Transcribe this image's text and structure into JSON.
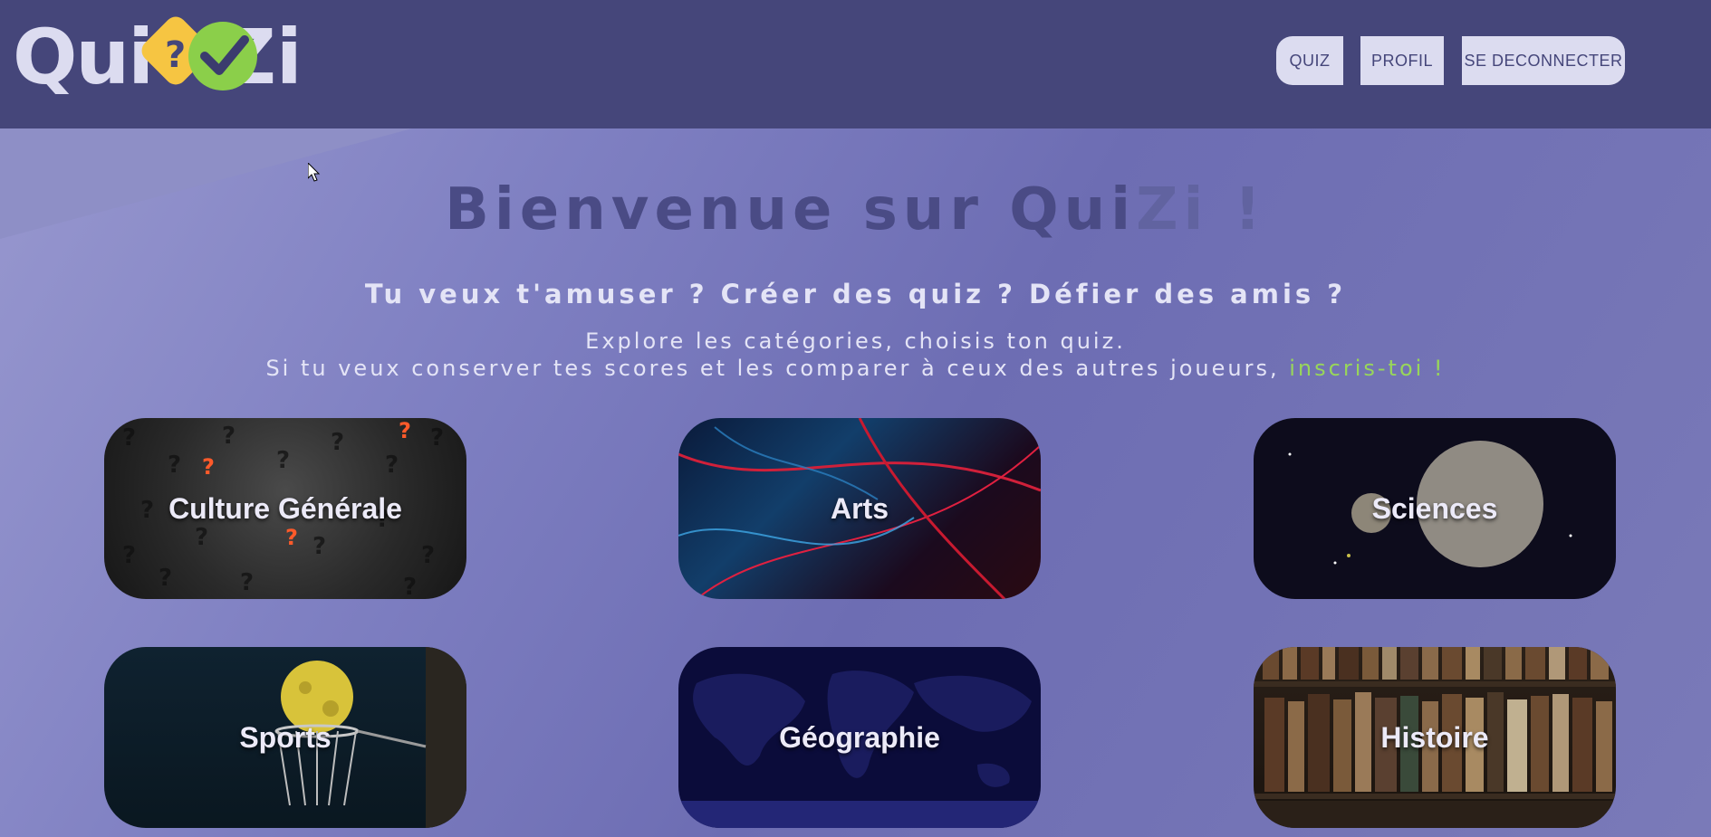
{
  "header": {
    "logo_text": "QuiZi",
    "nav": {
      "quiz": "QUIZ",
      "profil": "PROFIL",
      "logout": "SE DECONNECTER"
    }
  },
  "hero": {
    "title_main": "Bienvenue sur Qui",
    "title_fade": "Zi !",
    "subtitle": "Tu veux t'amuser ? Créer des quiz ? Défier des amis ?",
    "intro_line1": "Explore les catégories, choisis ton quiz.",
    "intro_line2": "Si tu veux conserver tes scores et les comparer à ceux des autres joueurs,",
    "signup_link": "inscris-toi !"
  },
  "categories": [
    {
      "label": "Culture Générale"
    },
    {
      "label": "Arts"
    },
    {
      "label": "Sciences"
    },
    {
      "label": "Sports"
    },
    {
      "label": "Géographie"
    },
    {
      "label": "Histoire"
    }
  ],
  "colors": {
    "header_bg": "#45467a",
    "accent_green": "#98d65a",
    "logo_yellow": "#f6c542"
  }
}
